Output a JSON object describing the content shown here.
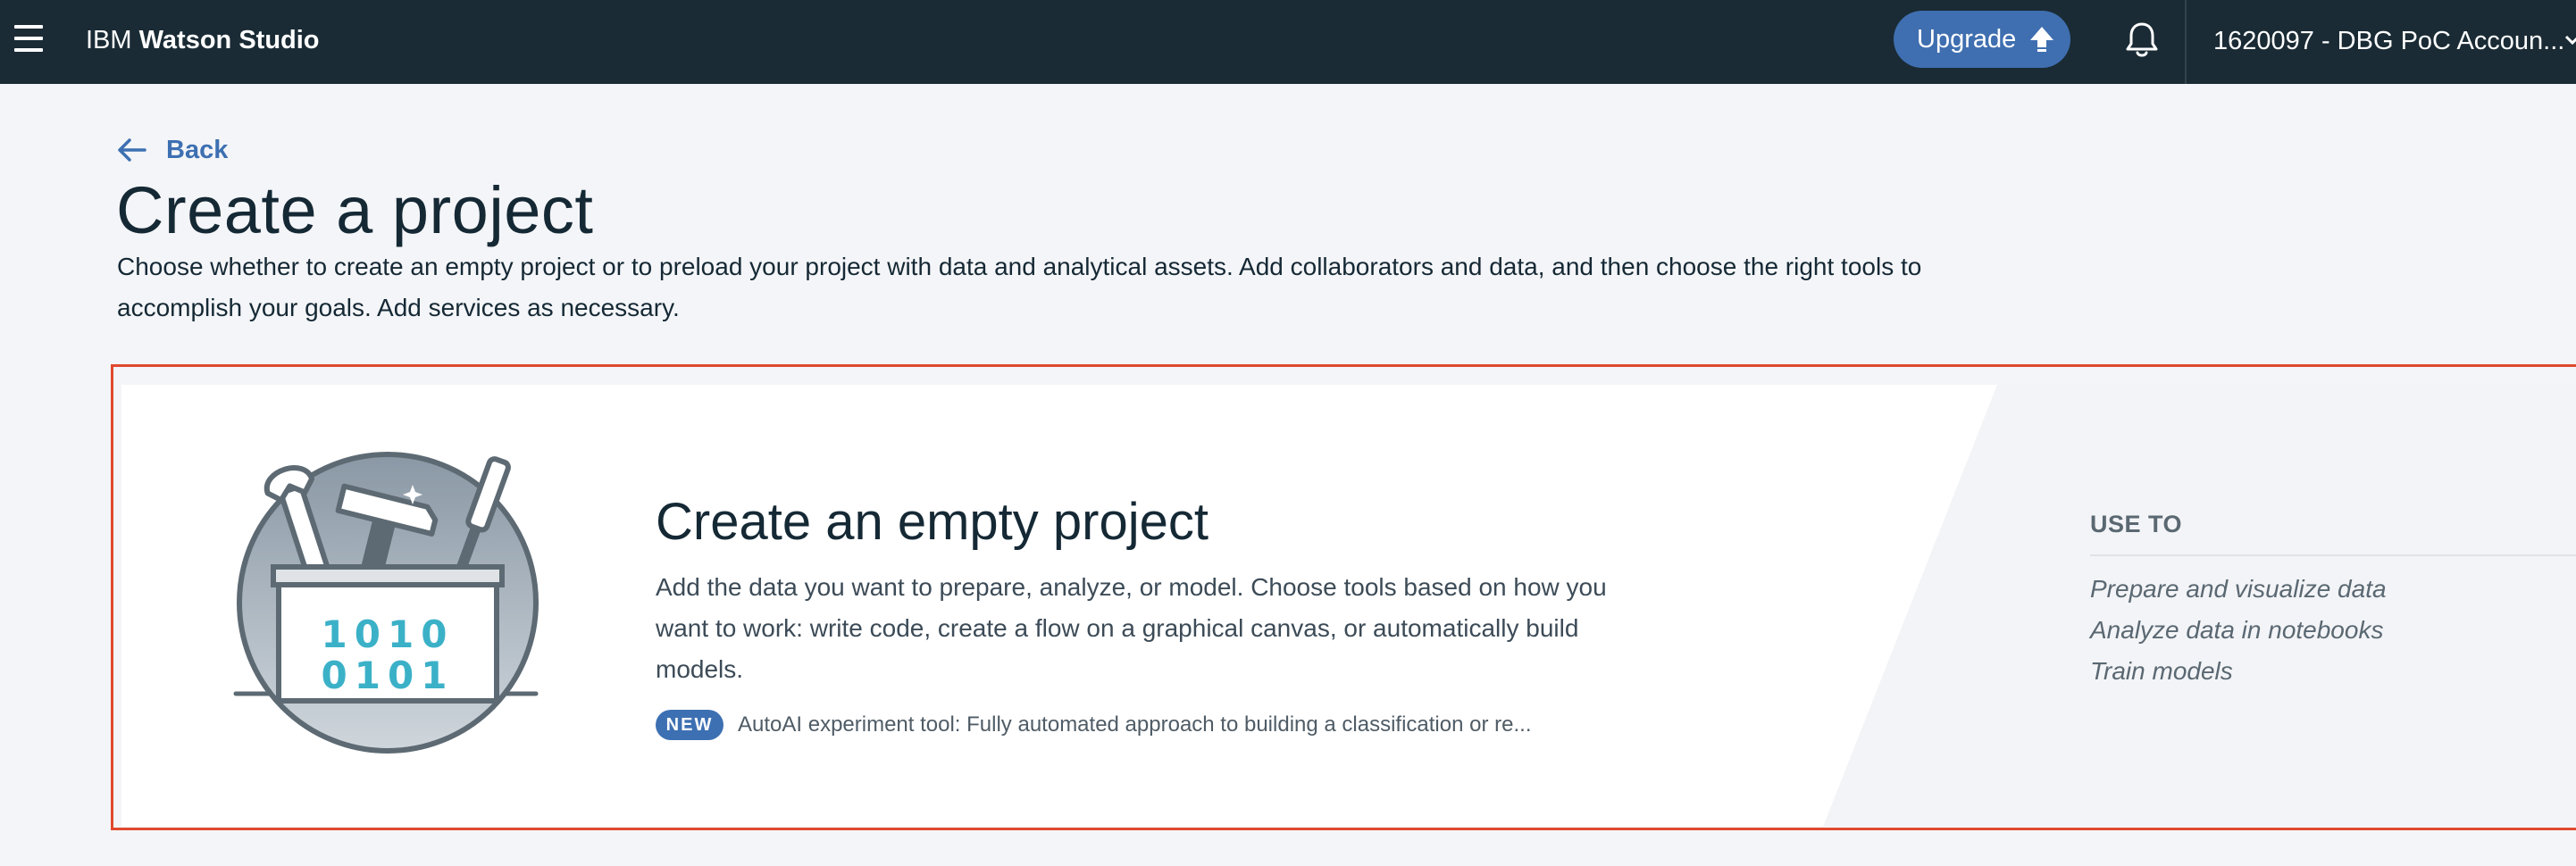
{
  "header": {
    "brand_prefix": "IBM",
    "brand_name": "Watson Studio",
    "upgrade_label": "Upgrade",
    "account_label": "1620097 - DBG PoC Accoun..."
  },
  "page": {
    "back_label": "Back",
    "title": "Create a project",
    "description": "Choose whether to create an empty project or to preload your project with data and analytical assets. Add collaborators and data, and then choose the right tools to accomplish your goals. Add services as necessary."
  },
  "card": {
    "title": "Create an empty project",
    "description": "Add the data you want to prepare, analyze, or model. Choose tools based on how you want to work: write code, create a flow on a graphical canvas, or automatically build models.",
    "new_badge": "NEW",
    "new_text": "AutoAI experiment tool: Fully automated approach to building a classification or re...",
    "illustration_binary": [
      "1010",
      "0101"
    ],
    "use_to": {
      "heading": "USE TO",
      "items": [
        "Prepare and visualize data",
        "Analyze data in notebooks",
        "Train models"
      ]
    }
  },
  "icons": {
    "menu": "hamburger-menu-icon",
    "upgrade": "arrow-up-icon",
    "notifications": "bell-icon",
    "account": "chevron-down-icon",
    "back": "arrow-left-icon",
    "illustration": "toolbox-illustration"
  },
  "colors": {
    "header_bg": "#1a2b35",
    "page_bg": "#f4f5f8",
    "accent_blue": "#3d70b2",
    "highlight_red": "#e0492e",
    "binary_teal": "#3bb1c8"
  }
}
